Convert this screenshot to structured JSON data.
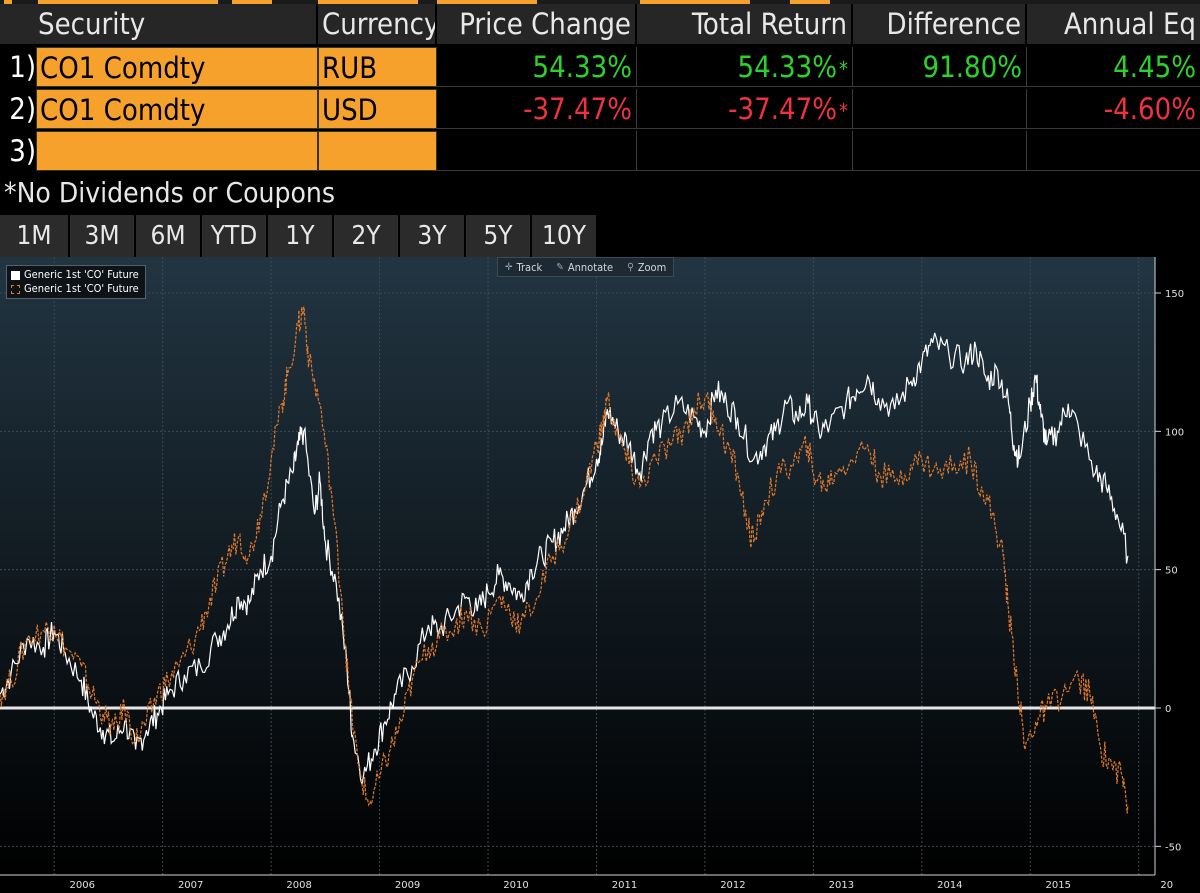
{
  "table": {
    "headers": {
      "security": "Security",
      "currency": "Currency",
      "price_change": "Price Change",
      "total_return": "Total Return",
      "difference": "Difference",
      "annual_eq": "Annual Eq"
    },
    "rows": [
      {
        "num": "1)",
        "security": "CO1 Comdty",
        "currency": "RUB",
        "price_change": "54.33%",
        "total_return": "54.33%",
        "star": "*",
        "difference": "91.80%",
        "annual_eq": "4.45%"
      },
      {
        "num": "2)",
        "security": "CO1 Comdty",
        "currency": "USD",
        "price_change": "-37.47%",
        "total_return": "-37.47%",
        "star": "*",
        "difference": "",
        "annual_eq": "-4.60%"
      },
      {
        "num": "3)",
        "security": "",
        "currency": "",
        "price_change": "",
        "total_return": "",
        "star": "",
        "difference": "",
        "annual_eq": ""
      }
    ]
  },
  "footnote": "*No Dividends or Coupons",
  "ranges": [
    "1M",
    "3M",
    "6M",
    "YTD",
    "1Y",
    "2Y",
    "3Y",
    "5Y",
    "10Y"
  ],
  "chart_toolbar": {
    "track": "Track",
    "annotate": "Annotate",
    "zoom": "Zoom"
  },
  "colors": {
    "accent": "#f7a12d",
    "positive": "#2bd22b",
    "negative": "#f0313f",
    "series_rub": "#ffffff",
    "series_usd": "#e0792b"
  },
  "chart_data": {
    "type": "line",
    "x_ticks": [
      "2006",
      "2007",
      "2008",
      "2009",
      "2010",
      "2011",
      "2012",
      "2013",
      "2014",
      "2015",
      "20"
    ],
    "y_ticks": [
      150,
      100,
      50,
      0,
      -50
    ],
    "ylim": [
      -55,
      160
    ],
    "xlim": [
      2005.5,
      2016.15
    ],
    "grid": true,
    "legend_position": "top-left",
    "series": [
      {
        "name": "Generic 1st 'CO' Future",
        "style": "solid",
        "points": [
          [
            2005.5,
            5
          ],
          [
            2005.6,
            12
          ],
          [
            2005.75,
            25
          ],
          [
            2005.9,
            22
          ],
          [
            2006.0,
            28
          ],
          [
            2006.1,
            20
          ],
          [
            2006.25,
            10
          ],
          [
            2006.35,
            -2
          ],
          [
            2006.45,
            -8
          ],
          [
            2006.55,
            -12
          ],
          [
            2006.65,
            -5
          ],
          [
            2006.75,
            -15
          ],
          [
            2006.85,
            -8
          ],
          [
            2006.95,
            -2
          ],
          [
            2007.05,
            5
          ],
          [
            2007.2,
            12
          ],
          [
            2007.35,
            15
          ],
          [
            2007.5,
            25
          ],
          [
            2007.6,
            30
          ],
          [
            2007.7,
            40
          ],
          [
            2007.8,
            38
          ],
          [
            2007.9,
            50
          ],
          [
            2008.0,
            55
          ],
          [
            2008.1,
            75
          ],
          [
            2008.2,
            85
          ],
          [
            2008.25,
            95
          ],
          [
            2008.3,
            100
          ],
          [
            2008.4,
            70
          ],
          [
            2008.45,
            82
          ],
          [
            2008.5,
            60
          ],
          [
            2008.6,
            45
          ],
          [
            2008.7,
            15
          ],
          [
            2008.75,
            -10
          ],
          [
            2008.85,
            -25
          ],
          [
            2008.95,
            -15
          ],
          [
            2009.05,
            -5
          ],
          [
            2009.15,
            5
          ],
          [
            2009.3,
            15
          ],
          [
            2009.45,
            30
          ],
          [
            2009.55,
            28
          ],
          [
            2009.7,
            35
          ],
          [
            2009.8,
            40
          ],
          [
            2009.9,
            35
          ],
          [
            2010.0,
            42
          ],
          [
            2010.1,
            48
          ],
          [
            2010.2,
            45
          ],
          [
            2010.3,
            40
          ],
          [
            2010.4,
            50
          ],
          [
            2010.5,
            55
          ],
          [
            2010.6,
            60
          ],
          [
            2010.7,
            65
          ],
          [
            2010.8,
            72
          ],
          [
            2010.9,
            80
          ],
          [
            2011.0,
            90
          ],
          [
            2011.05,
            95
          ],
          [
            2011.1,
            108
          ],
          [
            2011.2,
            100
          ],
          [
            2011.3,
            95
          ],
          [
            2011.4,
            85
          ],
          [
            2011.5,
            100
          ],
          [
            2011.6,
            102
          ],
          [
            2011.75,
            110
          ],
          [
            2011.9,
            105
          ],
          [
            2012.0,
            100
          ],
          [
            2012.1,
            115
          ],
          [
            2012.2,
            110
          ],
          [
            2012.3,
            105
          ],
          [
            2012.45,
            90
          ],
          [
            2012.55,
            95
          ],
          [
            2012.65,
            100
          ],
          [
            2012.75,
            110
          ],
          [
            2012.85,
            105
          ],
          [
            2012.95,
            110
          ],
          [
            2013.05,
            100
          ],
          [
            2013.15,
            102
          ],
          [
            2013.3,
            110
          ],
          [
            2013.4,
            115
          ],
          [
            2013.5,
            120
          ],
          [
            2013.6,
            112
          ],
          [
            2013.75,
            108
          ],
          [
            2013.9,
            118
          ],
          [
            2014.0,
            125
          ],
          [
            2014.1,
            132
          ],
          [
            2014.25,
            128
          ],
          [
            2014.4,
            125
          ],
          [
            2014.5,
            130
          ],
          [
            2014.6,
            118
          ],
          [
            2014.7,
            122
          ],
          [
            2014.8,
            110
          ],
          [
            2014.85,
            95
          ],
          [
            2014.9,
            90
          ],
          [
            2015.0,
            110
          ],
          [
            2015.05,
            120
          ],
          [
            2015.1,
            105
          ],
          [
            2015.15,
            95
          ],
          [
            2015.25,
            100
          ],
          [
            2015.35,
            110
          ],
          [
            2015.45,
            100
          ],
          [
            2015.6,
            85
          ],
          [
            2015.7,
            80
          ],
          [
            2015.8,
            70
          ],
          [
            2015.9,
            55
          ]
        ]
      },
      {
        "name": "Generic 1st 'CO' Future",
        "style": "dashed",
        "points": [
          [
            2005.5,
            5
          ],
          [
            2005.6,
            10
          ],
          [
            2005.75,
            25
          ],
          [
            2005.9,
            28
          ],
          [
            2006.0,
            30
          ],
          [
            2006.1,
            22
          ],
          [
            2006.25,
            15
          ],
          [
            2006.35,
            5
          ],
          [
            2006.45,
            -2
          ],
          [
            2006.55,
            -8
          ],
          [
            2006.65,
            0
          ],
          [
            2006.75,
            -12
          ],
          [
            2006.85,
            -5
          ],
          [
            2006.95,
            5
          ],
          [
            2007.05,
            10
          ],
          [
            2007.15,
            15
          ],
          [
            2007.3,
            25
          ],
          [
            2007.4,
            35
          ],
          [
            2007.5,
            45
          ],
          [
            2007.6,
            55
          ],
          [
            2007.7,
            62
          ],
          [
            2007.8,
            55
          ],
          [
            2007.9,
            70
          ],
          [
            2008.0,
            90
          ],
          [
            2008.1,
            110
          ],
          [
            2008.15,
            120
          ],
          [
            2008.25,
            138
          ],
          [
            2008.3,
            145
          ],
          [
            2008.35,
            125
          ],
          [
            2008.45,
            110
          ],
          [
            2008.55,
            80
          ],
          [
            2008.65,
            40
          ],
          [
            2008.72,
            5
          ],
          [
            2008.8,
            -20
          ],
          [
            2008.9,
            -35
          ],
          [
            2009.0,
            -25
          ],
          [
            2009.1,
            -15
          ],
          [
            2009.2,
            -5
          ],
          [
            2009.3,
            10
          ],
          [
            2009.45,
            22
          ],
          [
            2009.55,
            25
          ],
          [
            2009.7,
            30
          ],
          [
            2009.8,
            35
          ],
          [
            2009.95,
            28
          ],
          [
            2010.1,
            40
          ],
          [
            2010.2,
            35
          ],
          [
            2010.3,
            30
          ],
          [
            2010.45,
            40
          ],
          [
            2010.6,
            55
          ],
          [
            2010.75,
            65
          ],
          [
            2010.9,
            80
          ],
          [
            2011.0,
            95
          ],
          [
            2011.05,
            100
          ],
          [
            2011.1,
            112
          ],
          [
            2011.2,
            98
          ],
          [
            2011.3,
            88
          ],
          [
            2011.4,
            80
          ],
          [
            2011.55,
            90
          ],
          [
            2011.7,
            96
          ],
          [
            2011.8,
            100
          ],
          [
            2011.9,
            108
          ],
          [
            2012.0,
            112
          ],
          [
            2012.1,
            105
          ],
          [
            2012.2,
            95
          ],
          [
            2012.3,
            85
          ],
          [
            2012.4,
            65
          ],
          [
            2012.45,
            60
          ],
          [
            2012.55,
            75
          ],
          [
            2012.7,
            85
          ],
          [
            2012.85,
            90
          ],
          [
            2012.95,
            95
          ],
          [
            2013.0,
            85
          ],
          [
            2013.1,
            80
          ],
          [
            2013.2,
            85
          ],
          [
            2013.35,
            90
          ],
          [
            2013.5,
            95
          ],
          [
            2013.6,
            85
          ],
          [
            2013.75,
            82
          ],
          [
            2013.9,
            88
          ],
          [
            2014.0,
            90
          ],
          [
            2014.15,
            85
          ],
          [
            2014.3,
            88
          ],
          [
            2014.45,
            90
          ],
          [
            2014.55,
            80
          ],
          [
            2014.65,
            70
          ],
          [
            2014.75,
            55
          ],
          [
            2014.8,
            35
          ],
          [
            2014.88,
            10
          ],
          [
            2014.95,
            -15
          ],
          [
            2015.05,
            -5
          ],
          [
            2015.15,
            0
          ],
          [
            2015.3,
            5
          ],
          [
            2015.45,
            10
          ],
          [
            2015.55,
            5
          ],
          [
            2015.65,
            -15
          ],
          [
            2015.75,
            -20
          ],
          [
            2015.85,
            -25
          ],
          [
            2015.9,
            -35
          ]
        ]
      }
    ]
  }
}
